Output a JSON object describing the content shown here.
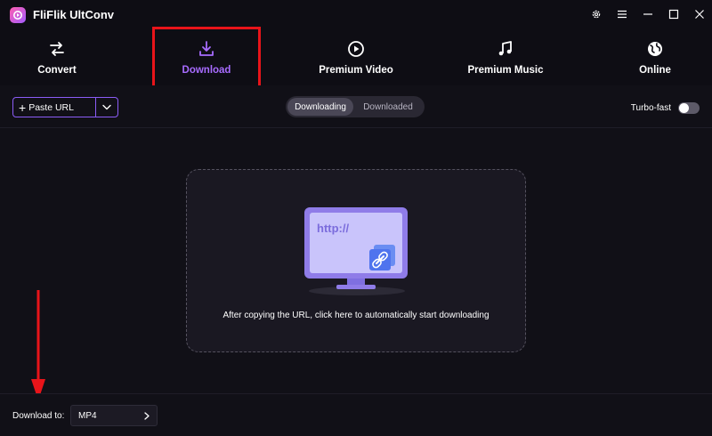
{
  "app": {
    "title": "FliFlik UltConv"
  },
  "nav": {
    "items": [
      {
        "label": "Convert",
        "icon": "convert-arrows-icon"
      },
      {
        "label": "Download",
        "icon": "download-icon",
        "active": true
      },
      {
        "label": "Premium Video",
        "icon": "play-circle-icon"
      },
      {
        "label": "Premium Music",
        "icon": "music-note-icon"
      },
      {
        "label": "Online",
        "icon": "globe-icon"
      }
    ]
  },
  "toolbar": {
    "paste_label": "Paste URL",
    "tabs": [
      "Downloading",
      "Downloaded"
    ],
    "turbo_label": "Turbo-fast",
    "turbo_on": false
  },
  "dropzone": {
    "illustration_text": "http://",
    "hint": "After copying the URL, click here to automatically start downloading"
  },
  "footer": {
    "download_to_label": "Download to:",
    "format_value": "MP4"
  },
  "colors": {
    "accent": "#a86cff",
    "highlight": "#e8141a",
    "background": "#111017"
  }
}
